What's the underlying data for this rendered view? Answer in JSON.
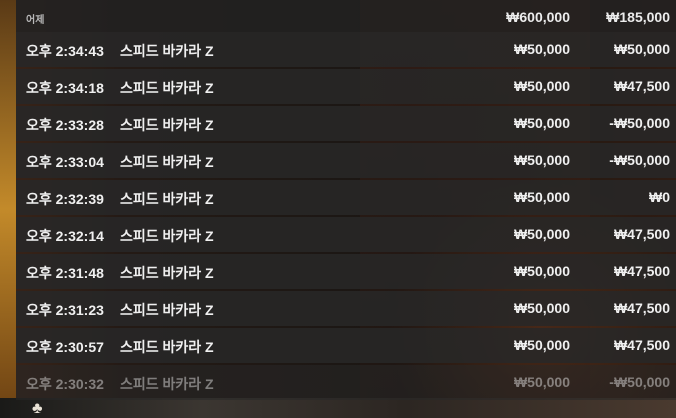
{
  "header": {
    "date_label": "어제",
    "total_stake": "₩600,000",
    "total_payout": "₩185,000"
  },
  "rows": [
    {
      "time": "오후 2:34:43",
      "game": "스피드 바카라 Z",
      "stake": "₩50,000",
      "payout": "₩50,000"
    },
    {
      "time": "오후 2:34:18",
      "game": "스피드 바카라 Z",
      "stake": "₩50,000",
      "payout": "₩47,500"
    },
    {
      "time": "오후 2:33:28",
      "game": "스피드 바카라 Z",
      "stake": "₩50,000",
      "payout": "-₩50,000"
    },
    {
      "time": "오후 2:33:04",
      "game": "스피드 바카라 Z",
      "stake": "₩50,000",
      "payout": "-₩50,000"
    },
    {
      "time": "오후 2:32:39",
      "game": "스피드 바카라 Z",
      "stake": "₩50,000",
      "payout": "₩0"
    },
    {
      "time": "오후 2:32:14",
      "game": "스피드 바카라 Z",
      "stake": "₩50,000",
      "payout": "₩47,500"
    },
    {
      "time": "오후 2:31:48",
      "game": "스피드 바카라 Z",
      "stake": "₩50,000",
      "payout": "₩47,500"
    },
    {
      "time": "오후 2:31:23",
      "game": "스피드 바카라 Z",
      "stake": "₩50,000",
      "payout": "₩47,500"
    },
    {
      "time": "오후 2:30:57",
      "game": "스피드 바카라 Z",
      "stake": "₩50,000",
      "payout": "₩47,500"
    },
    {
      "time": "오후 2:30:32",
      "game": "스피드 바카라 Z",
      "stake": "₩50,000",
      "payout": "-₩50,000"
    }
  ],
  "background": {
    "card_suit": "♣"
  }
}
